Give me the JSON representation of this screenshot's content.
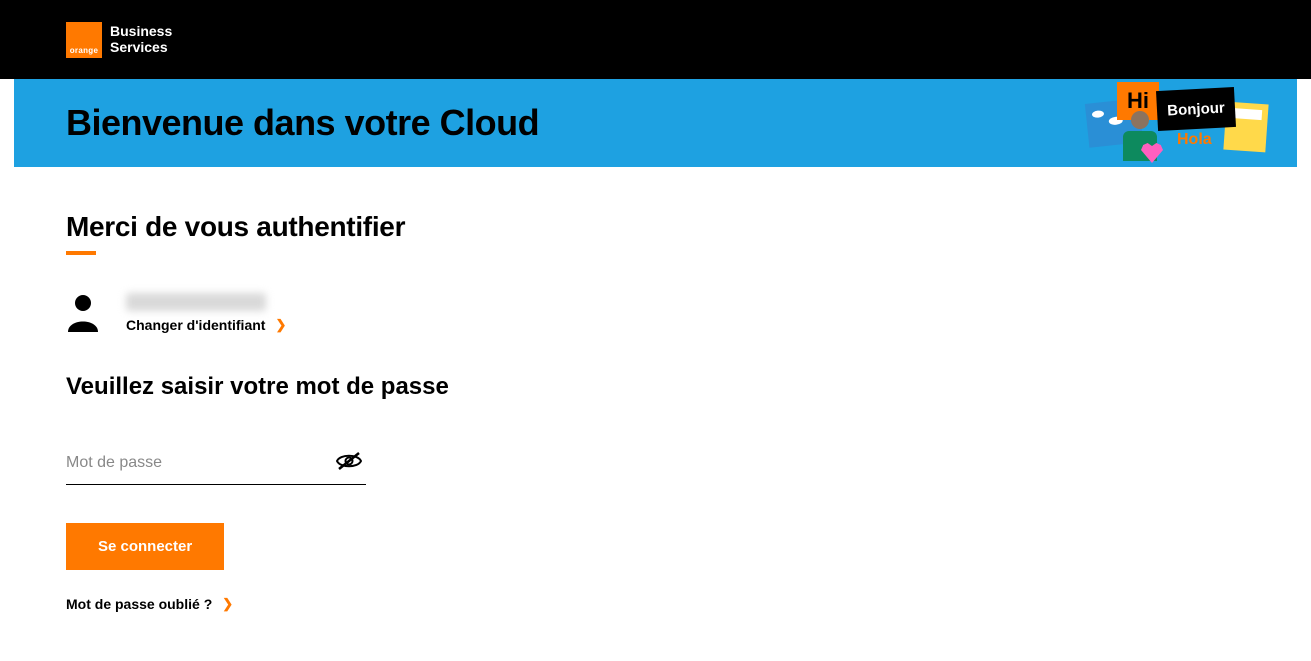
{
  "header": {
    "logo_word": "orange",
    "brand_line1": "Business",
    "brand_line2": "Services"
  },
  "banner": {
    "title": "Bienvenue dans votre Cloud",
    "hi": "Hi",
    "bonjour": "Bonjour",
    "hola": "Hola"
  },
  "auth": {
    "title": "Merci de vous authentifier",
    "change_id_label": "Changer d'identifiant",
    "password_title": "Veuillez saisir votre mot de passe",
    "password_placeholder": "Mot de passe",
    "login_label": "Se connecter",
    "forgot_label": "Mot de passe oublié ?"
  }
}
